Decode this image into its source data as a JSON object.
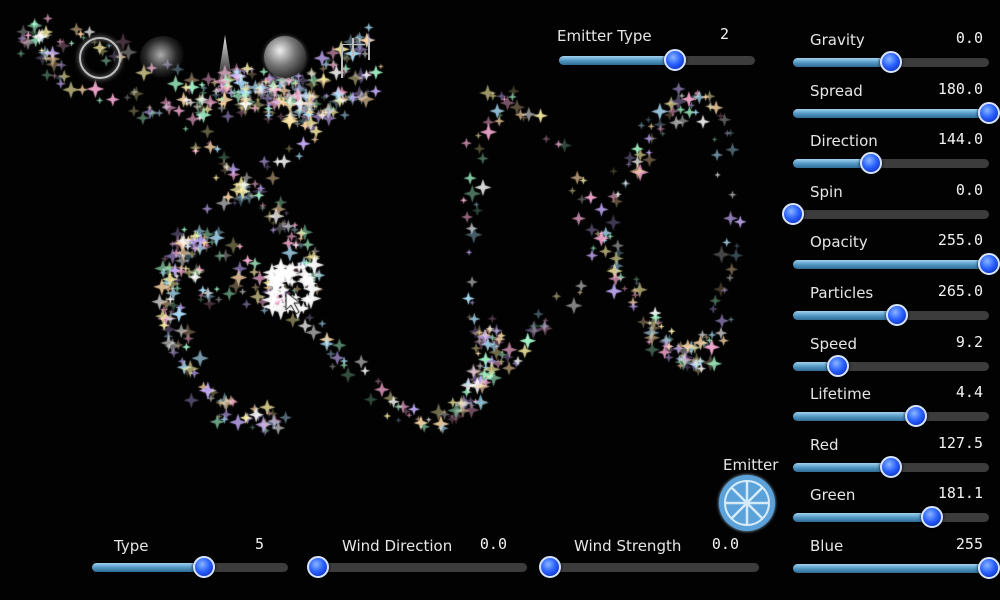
{
  "emitter_type": {
    "label": "Emitter Type",
    "value": "2",
    "fraction": 0.59
  },
  "presets": [
    "ring-preset-icon",
    "cloud-preset-icon",
    "spike-preset-icon",
    "bubble-preset-icon",
    "line-preset-icon"
  ],
  "side_sliders": [
    {
      "key": "gravity",
      "label": "Gravity",
      "value": "0.0",
      "fraction": 0.5
    },
    {
      "key": "spread",
      "label": "Spread",
      "value": "180.0",
      "fraction": 1.0
    },
    {
      "key": "direction",
      "label": "Direction",
      "value": "144.0",
      "fraction": 0.4
    },
    {
      "key": "spin",
      "label": "Spin",
      "value": "0.0",
      "fraction": 0.0
    },
    {
      "key": "opacity",
      "label": "Opacity",
      "value": "255.0",
      "fraction": 1.0
    },
    {
      "key": "particles",
      "label": "Particles",
      "value": "265.0",
      "fraction": 0.53
    },
    {
      "key": "speed",
      "label": "Speed",
      "value": "9.2",
      "fraction": 0.23
    },
    {
      "key": "lifetime",
      "label": "Lifetime",
      "value": "4.4",
      "fraction": 0.63
    },
    {
      "key": "red",
      "label": "Red",
      "value": "127.5",
      "fraction": 0.5
    },
    {
      "key": "green",
      "label": "Green",
      "value": "181.1",
      "fraction": 0.71
    },
    {
      "key": "blue",
      "label": "Blue",
      "value": "255",
      "fraction": 1.0
    }
  ],
  "bottom_sliders": [
    {
      "key": "type",
      "label": "Type",
      "value": "5",
      "fraction": 0.57
    },
    {
      "key": "wind_direction",
      "label": "Wind Direction",
      "value": "0.0",
      "fraction": 0.0
    },
    {
      "key": "wind_strength",
      "label": "Wind Strength",
      "value": "0.0",
      "fraction": 0.0
    }
  ],
  "emitter": {
    "label": "Emitter",
    "icon": "emitter-wheel-icon",
    "color": "#5ba2db"
  },
  "colors": {
    "accent": "#5ba2db",
    "thumb": "#2c63ff",
    "background": "#020202"
  }
}
